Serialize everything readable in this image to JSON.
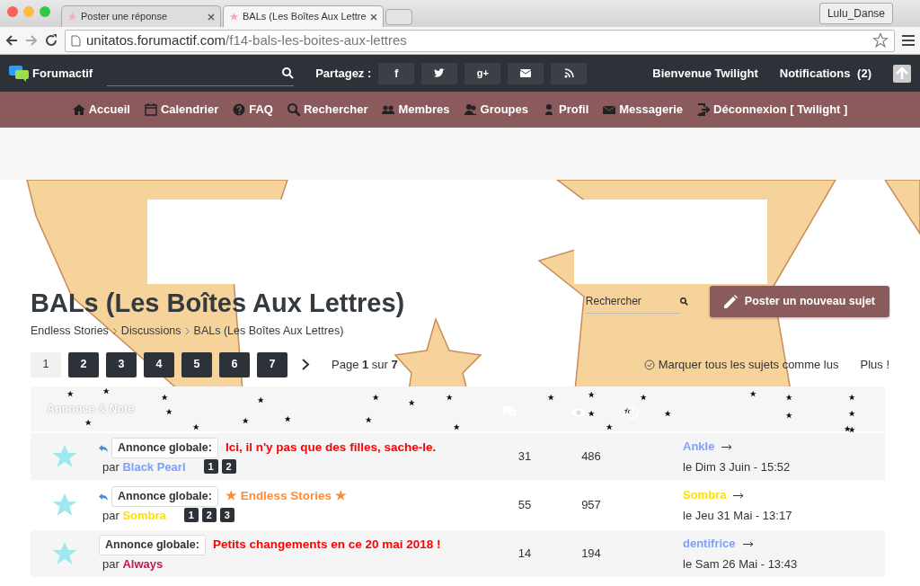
{
  "browser": {
    "tabs": [
      {
        "label": "Poster une réponse",
        "selected": false
      },
      {
        "label": "BALs (Les Boîtes Aux Lettre",
        "selected": true
      }
    ],
    "profile": "Lulu_Danse",
    "url_host": "unitatos.forumactif.com",
    "url_path": "/f14-bals-les-boites-aux-lettres"
  },
  "topbar": {
    "logo": "Forumactif",
    "share_label": "Partagez :",
    "share": [
      {
        "kind": "facebook",
        "glyph": "f"
      },
      {
        "kind": "twitter"
      },
      {
        "kind": "googleplus",
        "glyph": "g+"
      },
      {
        "kind": "email"
      },
      {
        "kind": "rss"
      }
    ],
    "welcome": "Bienvenue Twilight",
    "notifications": "Notifications",
    "notification_count": "(2)"
  },
  "nav": [
    {
      "label": "Accueil"
    },
    {
      "label": "Calendrier"
    },
    {
      "label": "FAQ"
    },
    {
      "label": "Rechercher"
    },
    {
      "label": "Membres"
    },
    {
      "label": "Groupes"
    },
    {
      "label": "Profil"
    },
    {
      "label": "Messagerie"
    },
    {
      "label": "Déconnexion [ Twilight ]"
    }
  ],
  "forum": {
    "title": "BALs (Les Boîtes Aux Lettres)",
    "breadcrumb": [
      "Endless Stories",
      "Discussions",
      "BALs (Les Boîtes Aux Lettres)"
    ],
    "search": {
      "placeholder": "Rechercher"
    },
    "new_topic": "Poster un nouveau sujet",
    "pages": [
      {
        "label": "1",
        "selected": true
      },
      {
        "label": "2",
        "selected": false
      },
      {
        "label": "3",
        "selected": false
      },
      {
        "label": "4",
        "selected": false
      },
      {
        "label": "5",
        "selected": false
      },
      {
        "label": "6",
        "selected": false
      },
      {
        "label": "7",
        "selected": false
      }
    ],
    "page_info": "Page **1** sur **7**",
    "mark_read": "Marquer tous les sujets comme lus",
    "more": "Plus !"
  },
  "table": {
    "header": "Annonce & Note",
    "rows": [
      {
        "reply": true,
        "tag": "Annonce globale:",
        "title": {
          "text": "Ici, il n'y pas que des filles, sache-le.",
          "color": "#ff0000"
        },
        "by": "par",
        "author": {
          "name": "Black Pearl",
          "color": "#7ea1f7"
        },
        "pages": [
          "1",
          "2"
        ],
        "replies": "31",
        "views": "486",
        "last_author": {
          "name": "Ankle",
          "color": "#7ea1f7"
        },
        "last_date": "le Dim 3 Juin - 15:52"
      },
      {
        "reply": true,
        "tag": "Annonce globale:",
        "title": {
          "text": "★ Endless Stories ★",
          "color": "#ff8c33"
        },
        "by": "par",
        "author": {
          "name": "Sombra",
          "color": "#ffe000"
        },
        "pages": [
          "1",
          "2",
          "3"
        ],
        "replies": "55",
        "views": "957",
        "last_author": {
          "name": "Sombra",
          "color": "#ffe000"
        },
        "last_date": "le Jeu 31 Mai - 13:17"
      },
      {
        "reply": false,
        "tag": "Annonce globale:",
        "title": {
          "text": "Petits changements en ce 20 mai 2018 !",
          "color": "#ff0000"
        },
        "by": "par",
        "author": {
          "name": "Always",
          "color": "#c2185b"
        },
        "pages": [],
        "replies": "14",
        "views": "194",
        "last_author": {
          "name": "dentifrice",
          "color": "#7ea1f7"
        },
        "last_date": "le Sam 26 Mai - 13:43"
      }
    ]
  }
}
